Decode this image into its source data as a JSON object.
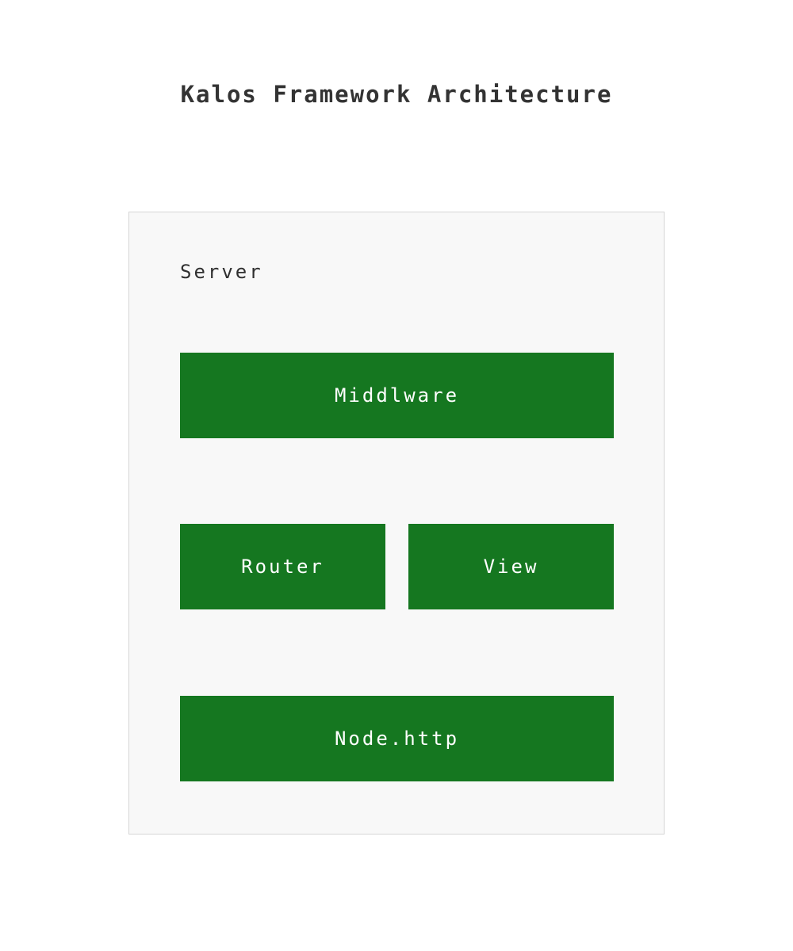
{
  "title": "Kalos Framework Architecture",
  "container": {
    "label": "Server"
  },
  "components": {
    "middleware": "Middlware",
    "router": "Router",
    "view": "View",
    "node_http": "Node.http"
  },
  "colors": {
    "component_fill": "#157720",
    "component_text": "#ffffff",
    "container_fill": "#f8f8f8",
    "container_border": "#d6d6d6",
    "title_text": "#333333"
  }
}
